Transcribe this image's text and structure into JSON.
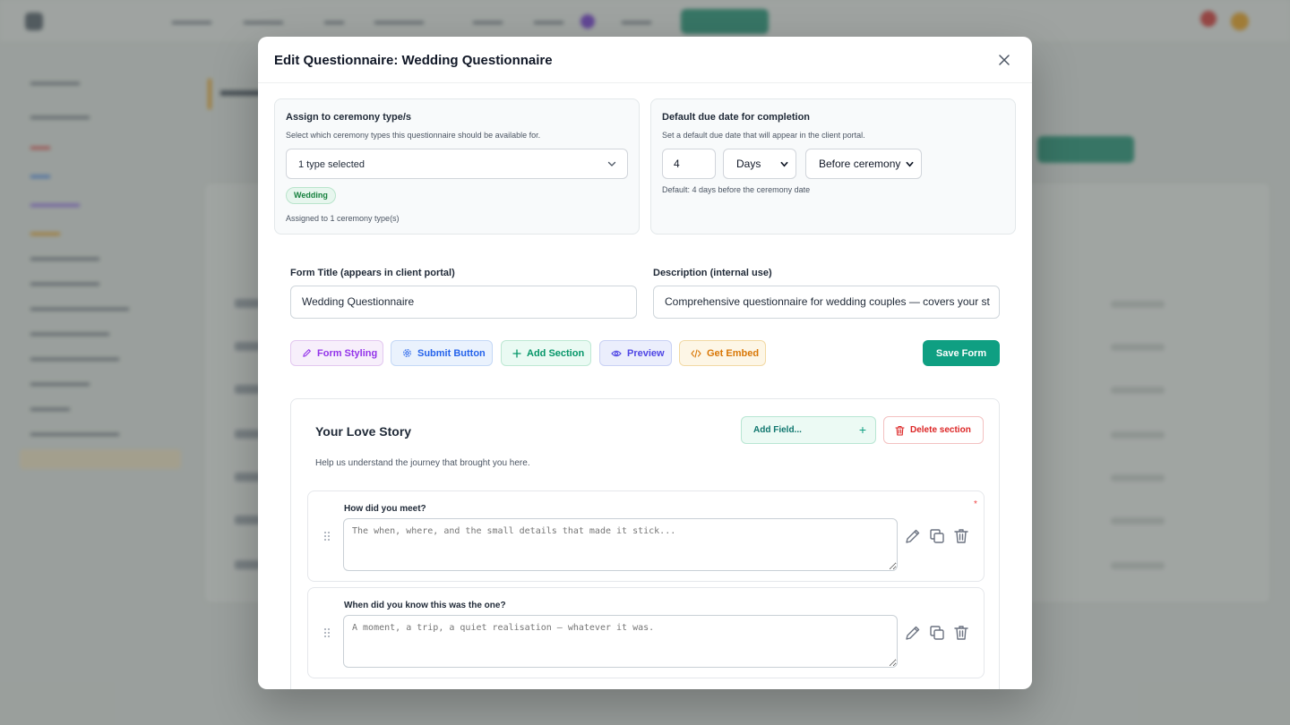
{
  "modal": {
    "title": "Edit Questionnaire: Wedding Questionnaire",
    "close_icon": "close-icon"
  },
  "assign_panel": {
    "title": "Assign to ceremony type/s",
    "subtitle": "Select which ceremony types this questionnaire should be available for.",
    "select_value": "1 type selected",
    "tags": [
      "Wedding"
    ],
    "assigned_note": "Assigned to 1 ceremony type(s)"
  },
  "due_panel": {
    "title": "Default due date for completion",
    "subtitle": "Set a default due date that will appear in the client portal.",
    "amount": "4",
    "unit": "Days",
    "relation": "Before ceremony",
    "note": "Default: 4 days before the ceremony date"
  },
  "form": {
    "title_label": "Form Title (appears in client portal)",
    "title_value": "Wedding Questionnaire",
    "description_label": "Description (internal use)",
    "description_value": "Comprehensive questionnaire for wedding couples — covers your st"
  },
  "toolbar": {
    "form_styling": "Form Styling",
    "submit_button": "Submit Button",
    "add_section": "Add Section",
    "preview": "Preview",
    "get_embed": "Get Embed",
    "save_form": "Save Form"
  },
  "section": {
    "title": "Your Love Story",
    "description": "Help us understand the journey that brought you here.",
    "add_field": "Add Field...",
    "delete_section": "Delete section",
    "questions": [
      {
        "label": "How did you meet?",
        "placeholder": "The when, where, and the small details that made it stick...",
        "required_mark": "*"
      },
      {
        "label": "When did you know this was the one?",
        "placeholder": "A moment, a trip, a quiet realisation — whatever it was."
      }
    ]
  },
  "colors": {
    "primary": "#0f9f82",
    "danger": "#dc2626",
    "tag_green": "#15803d"
  }
}
